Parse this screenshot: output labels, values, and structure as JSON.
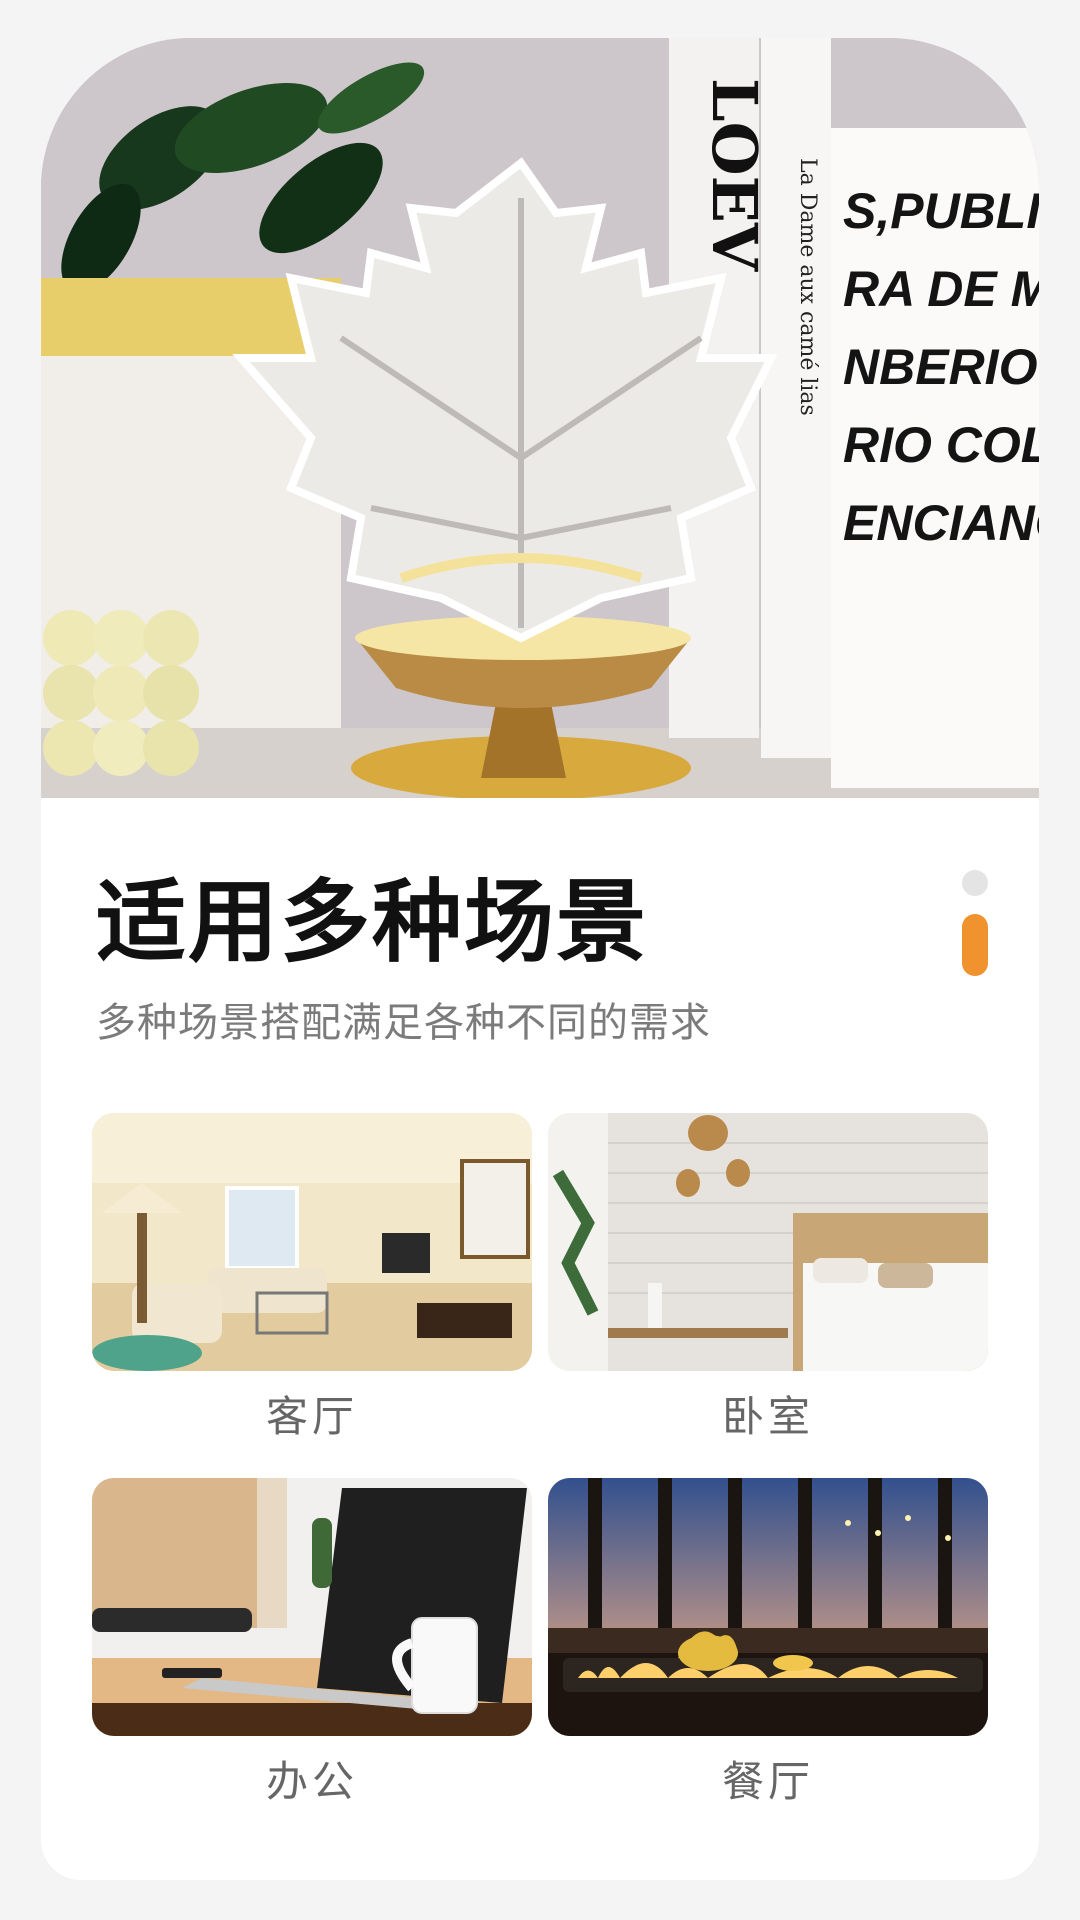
{
  "heading": {
    "title": "适用多种场景",
    "subtitle": "多种场景搭配满足各种不同的需求"
  },
  "hero": {
    "book_spine_1": "LOEV",
    "book_spine_2": "La Dame aux camé lias",
    "book_cover_lines": [
      "S,PUBLIC",
      "RA DE MAS",
      "NBERIOCO",
      "RIO COLECT",
      "ENCIANO\""
    ]
  },
  "pager": {
    "active_index": 1,
    "count": 2,
    "colors": {
      "active": "#f0922d",
      "inactive": "#e4e4e4"
    }
  },
  "scenes": [
    {
      "label": "客厅",
      "icon": "living-room-photo"
    },
    {
      "label": "卧室",
      "icon": "bedroom-photo"
    },
    {
      "label": "办公",
      "icon": "office-photo"
    },
    {
      "label": "餐厅",
      "icon": "restaurant-photo"
    }
  ]
}
